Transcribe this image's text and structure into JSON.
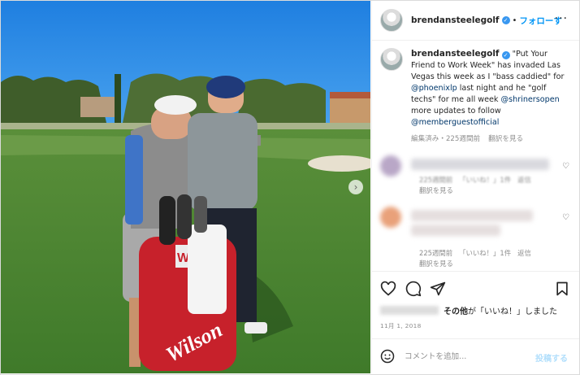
{
  "header": {
    "username": "brendansteelegolf",
    "separator": "•",
    "follow_label": "フォローす",
    "more_label": "···"
  },
  "caption": {
    "username": "brendansteelegolf",
    "text_1": "\"Put Your Friend to Work Week\" has invaded Las Vegas this week as I \"bass caddied\" for ",
    "mention_1": "@phoenixlp",
    "text_2": " last night and he \"golf techs\" for me all week ",
    "mention_2": "@shrinersopen",
    "text_3": " more updates to follow ",
    "mention_3": "@memberguestofficial",
    "edited": "編集済み・225週間前",
    "translate": "翻訳を見る"
  },
  "comments": [
    {
      "time": "225週間前",
      "likes": "「いいね！」1件",
      "reply": "返信",
      "translate": "翻訳を見る"
    },
    {
      "time": "225週間前",
      "likes": "「いいね！」1件",
      "reply": "返信",
      "translate": "翻訳を見る"
    }
  ],
  "likes": {
    "others": "その他",
    "suffix": "が「いいね！」しました"
  },
  "date": "11月 1, 2018",
  "add_comment": {
    "placeholder": "コメントを追加...",
    "post_label": "投稿する"
  },
  "photo": {
    "next_arrow": "›"
  },
  "icons": {
    "header_avatar": "avatar-icon",
    "verified": "verified-badge-icon",
    "like": "heart-icon",
    "comment": "comment-bubble-icon",
    "share": "paper-plane-icon",
    "save": "bookmark-icon",
    "emoji": "smiley-icon"
  },
  "colors": {
    "link": "#00376b",
    "follow": "#0095f6",
    "meta": "#8e8e8e",
    "post_disabled": "#b2dffc"
  }
}
